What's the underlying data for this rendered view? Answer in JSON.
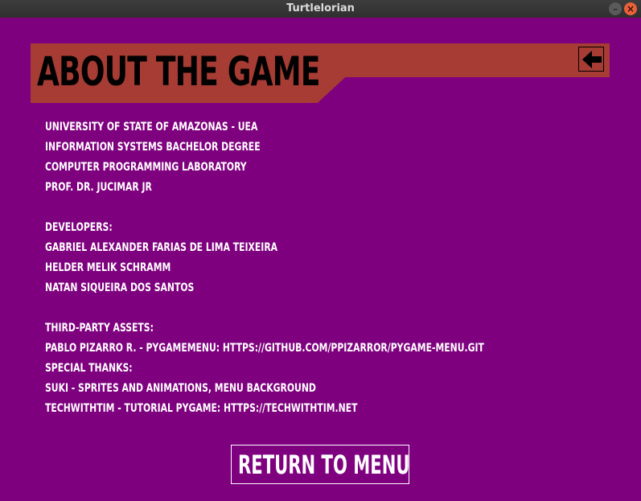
{
  "window": {
    "title": "Turtlelorian",
    "minimize_icon": "minimize-icon",
    "close_icon": "close-icon"
  },
  "header": {
    "title": "ABOUT THE GAME",
    "back_icon": "arrow-left-icon"
  },
  "credits": {
    "institution": [
      "UNIVERSITY OF STATE OF AMAZONAS - UEA",
      "INFORMATION SYSTEMS BACHELOR DEGREE",
      "COMPUTER PROGRAMMING LABORATORY",
      "PROF. DR. JUCIMAR JR"
    ],
    "developers_heading": "DEVELOPERS:",
    "developers": [
      "GABRIEL ALEXANDER FARIAS DE LIMA TEIXEIRA",
      "HELDER MELIK SCHRAMM",
      "NATAN SIQUEIRA DOS SANTOS"
    ],
    "assets_heading": "THIRD-PARTY ASSETS:",
    "assets": [
      "PABLO PIZARRO R. - PYGAMEMENU: HTTPS://GITHUB.COM/PPIZARROR/PYGAME-MENU.GIT"
    ],
    "thanks_heading": "SPECIAL THANKS:",
    "thanks": [
      "SUKI - SPRITES AND ANIMATIONS, MENU BACKGROUND",
      "TECHWITHTIM - TUTORIAL PYGAME: HTTPS://TECHWITHTIM.NET"
    ]
  },
  "footer": {
    "return_label": "RETURN TO MENU"
  },
  "colors": {
    "background": "#7f007f",
    "banner": "#a63c34",
    "text": "#ffffff"
  }
}
